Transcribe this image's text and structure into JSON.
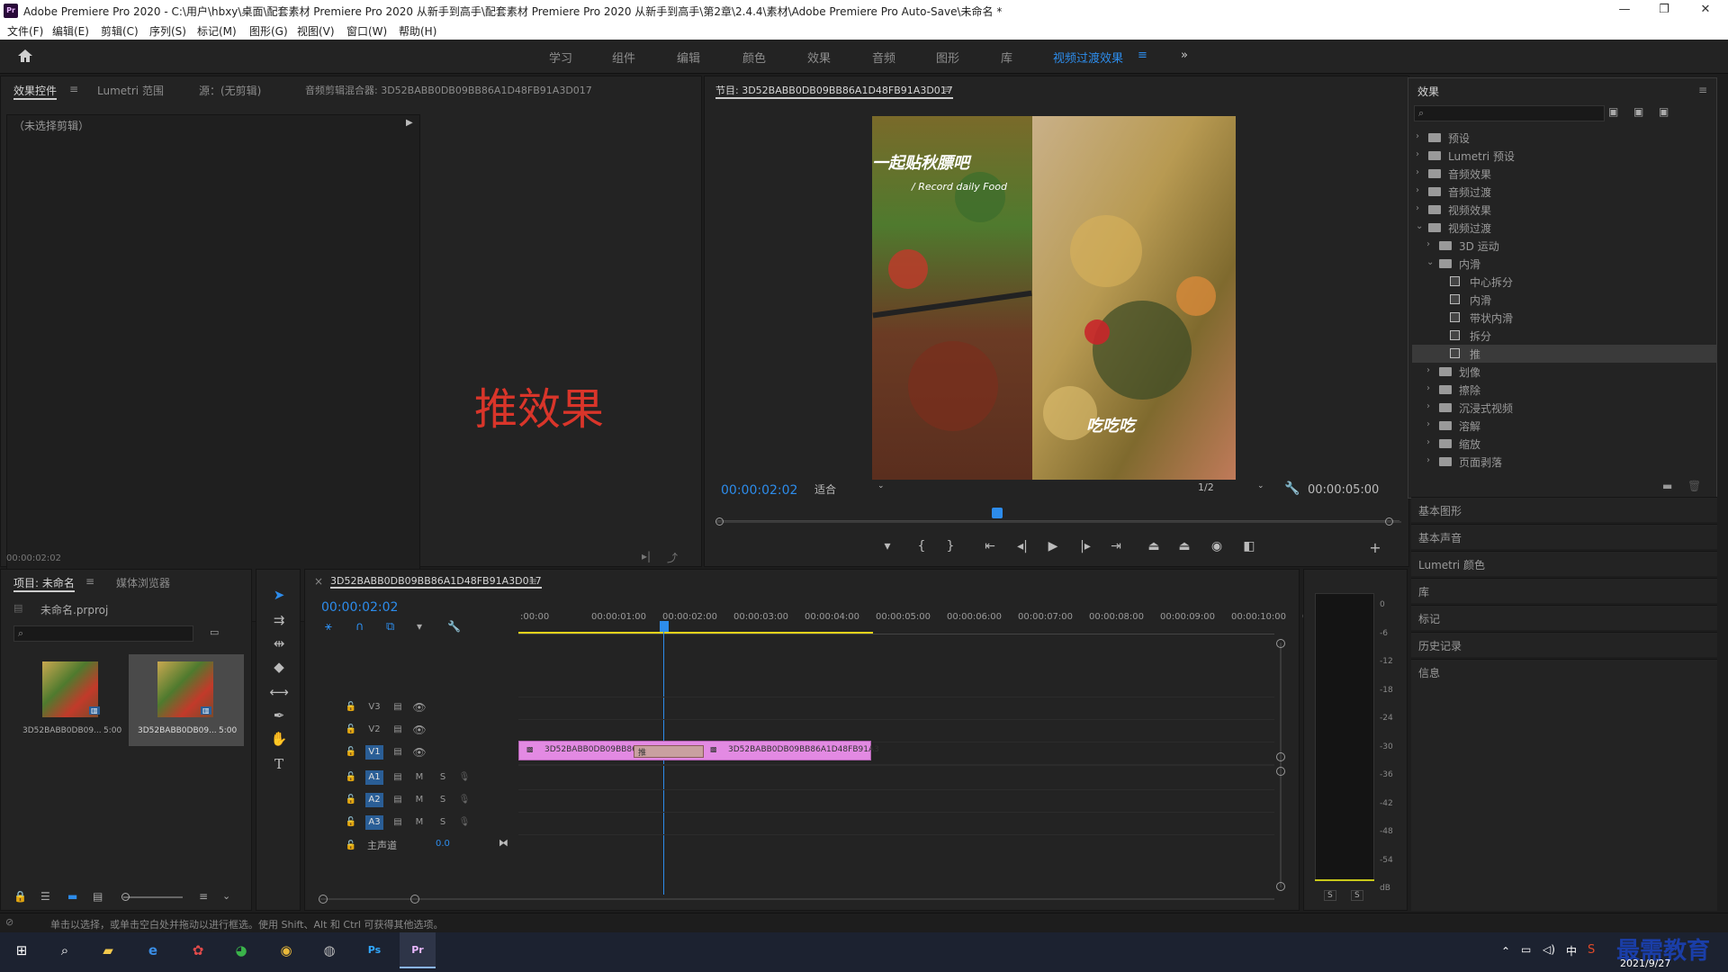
{
  "window": {
    "title": "Adobe Premiere Pro 2020 - C:\\用户\\hbxy\\桌面\\配套素材 Premiere Pro 2020 从新手到高手\\配套素材 Premiere Pro 2020 从新手到高手\\第2章\\2.4.4\\素材\\Adobe Premiere Pro Auto-Save\\未命名 *",
    "logo": "Pr",
    "minimize": "—",
    "maximize": "❐",
    "close": "✕"
  },
  "menu": [
    "文件(F)",
    "编辑(E)",
    "剪辑(C)",
    "序列(S)",
    "标记(M)",
    "图形(G)",
    "视图(V)",
    "窗口(W)",
    "帮助(H)"
  ],
  "workspaces": {
    "items": [
      "学习",
      "组件",
      "编辑",
      "颜色",
      "效果",
      "音频",
      "图形",
      "库",
      "视频过渡效果"
    ],
    "active_index": 8,
    "more": "»"
  },
  "source_panel": {
    "tabs": [
      "效果控件",
      "Lumetri 范围",
      "源：(无剪辑)",
      "音频剪辑混合器: 3D52BABB0DB09BB86A1D48FB91A3D017"
    ],
    "no_clip": "（未选择剪辑）",
    "timecode": "00:00:02:02",
    "overlay_text": "推效果",
    "overlay_color": "#d9352a"
  },
  "program": {
    "title": "节目: 3D52BABB0DB09BB86A1D48FB91A3D017",
    "timecode": "00:00:02:02",
    "fit": "适合",
    "resolution": "1/2",
    "duration": "00:00:05:00",
    "caption1": "一起贴秋膘吧",
    "caption2": "/ Record daily Food",
    "caption3": "吃吃吃",
    "playhead_fraction": 0.41
  },
  "effects_panel": {
    "title": "效果",
    "search_placeholder": "",
    "tree": [
      {
        "label": "预设",
        "level": 0,
        "type": "folder",
        "expanded": false
      },
      {
        "label": "Lumetri 预设",
        "level": 0,
        "type": "folder",
        "expanded": false
      },
      {
        "label": "音频效果",
        "level": 0,
        "type": "folder",
        "expanded": false
      },
      {
        "label": "音频过渡",
        "level": 0,
        "type": "folder",
        "expanded": false
      },
      {
        "label": "视频效果",
        "level": 0,
        "type": "folder",
        "expanded": false
      },
      {
        "label": "视频过渡",
        "level": 0,
        "type": "folder",
        "expanded": true
      },
      {
        "label": "3D 运动",
        "level": 1,
        "type": "folder",
        "expanded": false
      },
      {
        "label": "内滑",
        "level": 1,
        "type": "folder",
        "expanded": true
      },
      {
        "label": "中心拆分",
        "level": 2,
        "type": "effect"
      },
      {
        "label": "内滑",
        "level": 2,
        "type": "effect"
      },
      {
        "label": "带状内滑",
        "level": 2,
        "type": "effect"
      },
      {
        "label": "拆分",
        "level": 2,
        "type": "effect"
      },
      {
        "label": "推",
        "level": 2,
        "type": "effect",
        "selected": true
      },
      {
        "label": "划像",
        "level": 1,
        "type": "folder",
        "expanded": false
      },
      {
        "label": "擦除",
        "level": 1,
        "type": "folder",
        "expanded": false
      },
      {
        "label": "沉浸式视频",
        "level": 1,
        "type": "folder",
        "expanded": false
      },
      {
        "label": "溶解",
        "level": 1,
        "type": "folder",
        "expanded": false
      },
      {
        "label": "缩放",
        "level": 1,
        "type": "folder",
        "expanded": false
      },
      {
        "label": "页面剥落",
        "level": 1,
        "type": "folder",
        "expanded": false
      }
    ],
    "sections": [
      "基本图形",
      "基本声音",
      "Lumetri 颜色",
      "库",
      "标记",
      "历史记录",
      "信息"
    ]
  },
  "project": {
    "tabs": [
      "项目: 未命名",
      "媒体浏览器"
    ],
    "file": "未命名.prproj",
    "clips": [
      {
        "name": "3D52BABB0DB09...",
        "duration": "5:00"
      },
      {
        "name": "3D52BABB0DB09...",
        "duration": "5:00"
      }
    ]
  },
  "timeline": {
    "tab": "3D52BABB0DB09BB86A1D48FB91A3D017",
    "timecode": "00:00:02:02",
    "ruler": [
      ":00:00",
      "00:00:01:00",
      "00:00:02:00",
      "00:00:03:00",
      "00:00:04:00",
      "00:00:05:00",
      "00:00:06:00",
      "00:00:07:00",
      "00:00:08:00",
      "00:00:09:00",
      "00:00:10:00",
      "0"
    ],
    "video_tracks": [
      "V3",
      "V2",
      "V1"
    ],
    "audio_tracks": [
      "A1",
      "A2",
      "A3"
    ],
    "master": "主声道",
    "master_value": "0.0",
    "clip1": "3D52BABB0DB09BB86",
    "clip2": "3D52BABB0DB09BB86A1D48FB91A3",
    "transition": "推",
    "mute": "M",
    "solo": "S"
  },
  "meter": {
    "scale": [
      "0",
      "-6",
      "-12",
      "-18",
      "-24",
      "-30",
      "-36",
      "-42",
      "-48",
      "-54",
      "dB"
    ],
    "solo": [
      "S",
      "S"
    ]
  },
  "status": "单击以选择，或单击空白处并拖动以进行框选。使用 Shift、Alt 和 Ctrl 可获得其他选项。",
  "taskbar": {
    "ime": "中",
    "watermark": "最需教育",
    "date": "2021/9/27"
  }
}
